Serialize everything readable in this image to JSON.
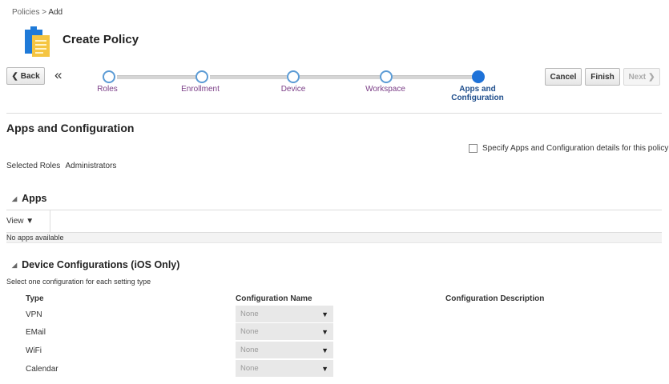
{
  "breadcrumb": {
    "parent": "Policies",
    "separator": " > ",
    "current": "Add"
  },
  "page": {
    "title": "Create Policy",
    "icon": "clipboard-document-icon"
  },
  "toolbar": {
    "back_label": "Back",
    "collapse_glyph": "«",
    "cancel_label": "Cancel",
    "finish_label": "Finish",
    "next_label": "Next"
  },
  "train": {
    "steps": [
      {
        "label": "Roles",
        "state": "visited"
      },
      {
        "label": "Enrollment",
        "state": "visited"
      },
      {
        "label": "Device",
        "state": "visited"
      },
      {
        "label": "Workspace",
        "state": "visited"
      },
      {
        "label": "Apps and",
        "label2": "Configuration",
        "state": "current"
      }
    ]
  },
  "section": {
    "title": "Apps and Configuration",
    "specify_checkbox_label": "Specify Apps and Configuration details for this policy",
    "specify_checked": false,
    "selected_roles_label": "Selected Roles",
    "selected_roles_value": "Administrators"
  },
  "apps": {
    "header": "Apps",
    "view_label": "View ▼",
    "empty_text": "No apps available"
  },
  "device_config": {
    "header": "Device Configurations (iOS Only)",
    "hint": "Select one configuration for each setting type",
    "columns": {
      "type": "Type",
      "name": "Configuration Name",
      "description": "Configuration Description"
    },
    "rows": [
      {
        "type": "VPN",
        "value": "None"
      },
      {
        "type": "EMail",
        "value": "None"
      },
      {
        "type": "WiFi",
        "value": "None"
      },
      {
        "type": "Calendar",
        "value": "None"
      }
    ]
  },
  "colors": {
    "accent": "#1f72d8",
    "stop_border": "#5b9bd5",
    "label_purple": "#7a3d86"
  }
}
